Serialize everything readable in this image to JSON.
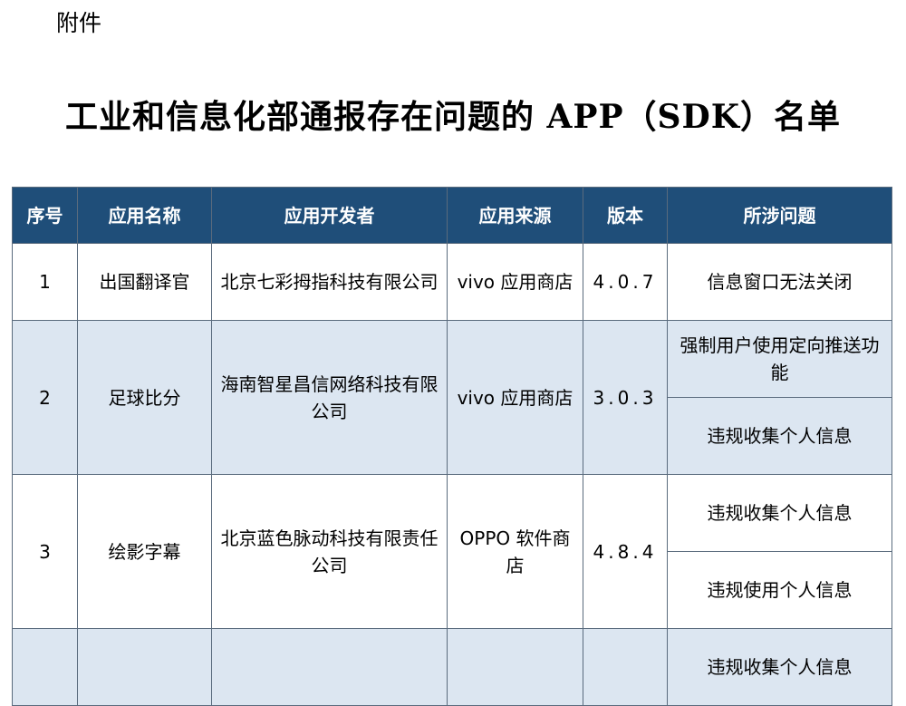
{
  "attachment_label": "附件",
  "title": "工业和信息化部通报存在问题的 APP（SDK）名单",
  "table": {
    "headers": [
      "序号",
      "应用名称",
      "应用开发者",
      "应用来源",
      "版本",
      "所涉问题"
    ],
    "rows": [
      {
        "num": "1",
        "app": "出国翻译官",
        "developer": "北京七彩拇指科技有限公司",
        "source": "vivo 应用商店",
        "version": "4.0.7",
        "issues": [
          "信息窗口无法关闭"
        ]
      },
      {
        "num": "2",
        "app": "足球比分",
        "developer": "海南智星昌信网络科技有限公司",
        "source": "vivo 应用商店",
        "version": "3.0.3",
        "issues": [
          "强制用户使用定向推送功能",
          "违规收集个人信息"
        ]
      },
      {
        "num": "3",
        "app": "绘影字幕",
        "developer": "北京蓝色脉动科技有限责任公司",
        "source": "OPPO 软件商店",
        "version": "4.8.4",
        "issues": [
          "违规收集个人信息",
          "违规使用个人信息"
        ]
      },
      {
        "num": "",
        "app": "",
        "developer": "",
        "source": "",
        "version": "",
        "issues": [
          "违规收集个人信息"
        ]
      }
    ]
  }
}
